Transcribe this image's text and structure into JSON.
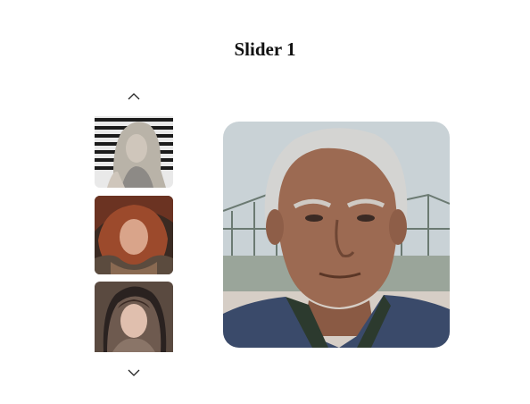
{
  "title": "Slider 1",
  "icons": {
    "up": "chevron-up-icon",
    "down": "chevron-down-icon"
  },
  "thumbnails": [
    {
      "name": "woman-striped-background"
    },
    {
      "name": "red-haired-woman-lying"
    },
    {
      "name": "woman-in-headscarf"
    }
  ],
  "main_image": {
    "name": "elderly-man-portrait"
  }
}
